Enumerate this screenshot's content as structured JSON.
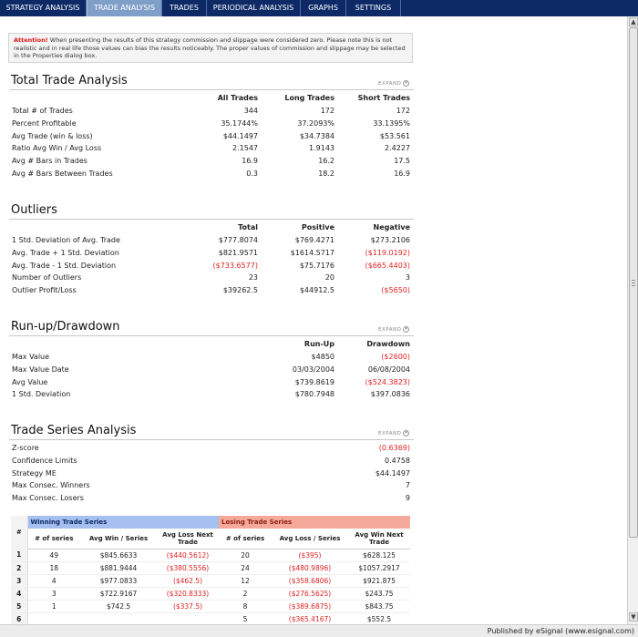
{
  "tabs": [
    "STRATEGY ANALYSIS",
    "TRADE ANALYSIS",
    "TRADES",
    "PERIODICAL ANALYSIS",
    "GRAPHS",
    "SETTINGS"
  ],
  "active_tab": "TRADE ANALYSIS",
  "attention": {
    "label": "Attention!",
    "text": "When presenting the results of this strategy commission and slippage were considered zero. Please note this is not realistic and in real life those values can bias the results noticeably. The proper values of commission and slippage may be selected in the Properties dialog box."
  },
  "expand_label": "EXPAND",
  "total_trade": {
    "title": "Total Trade Analysis",
    "headers": [
      "All Trades",
      "Long Trades",
      "Short Trades"
    ],
    "rows": [
      {
        "label": "Total # of Trades",
        "values": [
          "344",
          "172",
          "172"
        ]
      },
      {
        "label": "Percent Profitable",
        "values": [
          "35.1744%",
          "37.2093%",
          "33.1395%"
        ]
      },
      {
        "label": "Avg Trade (win & loss)",
        "values": [
          "$44.1497",
          "$34.7384",
          "$53.561"
        ]
      },
      {
        "label": "Ratio Avg Win / Avg Loss",
        "values": [
          "2.1547",
          "1.9143",
          "2.4227"
        ]
      },
      {
        "label": "Avg # Bars in Trades",
        "values": [
          "16.9",
          "16.2",
          "17.5"
        ]
      },
      {
        "label": "Avg # Bars Between Trades",
        "values": [
          "0.3",
          "18.2",
          "16.9"
        ]
      }
    ]
  },
  "outliers": {
    "title": "Outliers",
    "headers": [
      "Total",
      "Positive",
      "Negative"
    ],
    "rows": [
      {
        "label": "1 Std. Deviation of Avg. Trade",
        "values": [
          "$777.8074",
          "$769.4271",
          "$273.2106"
        ],
        "neg": [
          false,
          false,
          false
        ]
      },
      {
        "label": "Avg. Trade + 1 Std. Deviation",
        "values": [
          "$821.9571",
          "$1614.5717",
          "($119.0192)"
        ],
        "neg": [
          false,
          false,
          true
        ]
      },
      {
        "label": "Avg. Trade - 1 Std. Deviation",
        "values": [
          "($733.6577)",
          "$75.7176",
          "($665.4403)"
        ],
        "neg": [
          true,
          false,
          true
        ]
      },
      {
        "label": "Number of Outliers",
        "values": [
          "23",
          "20",
          "3"
        ],
        "neg": [
          false,
          false,
          false
        ]
      },
      {
        "label": "Outlier Profit/Loss",
        "values": [
          "$39262.5",
          "$44912.5",
          "($5650)"
        ],
        "neg": [
          false,
          false,
          true
        ]
      }
    ]
  },
  "runup": {
    "title": "Run-up/Drawdown",
    "headers": [
      "Run-Up",
      "Drawdown"
    ],
    "rows": [
      {
        "label": "Max Value",
        "values": [
          "$4850",
          "($2600)"
        ],
        "neg": [
          false,
          true
        ]
      },
      {
        "label": "Max Value Date",
        "values": [
          "03/03/2004",
          "06/08/2004"
        ],
        "neg": [
          false,
          false
        ]
      },
      {
        "label": "Avg Value",
        "values": [
          "$739.8619",
          "($524.3823)"
        ],
        "neg": [
          false,
          true
        ]
      },
      {
        "label": "1 Std. Deviation",
        "values": [
          "$780.7948",
          "$397.0836"
        ],
        "neg": [
          false,
          false
        ]
      }
    ]
  },
  "trade_series": {
    "title": "Trade Series Analysis",
    "rows": [
      {
        "label": "Z-score",
        "value": "(0.6369)",
        "neg": true
      },
      {
        "label": "Confidence Limits",
        "value": "0.4758",
        "neg": false
      },
      {
        "label": "Strategy ME",
        "value": "$44.1497",
        "neg": false
      },
      {
        "label": "Max Consec. Winners",
        "value": "7",
        "neg": false
      },
      {
        "label": "Max Consec. Losers",
        "value": "9",
        "neg": false
      }
    ]
  },
  "series_table": {
    "idx_header": "#",
    "win_header": "Winning Trade Series",
    "lose_header": "Losing Trade Series",
    "columns": [
      "# of series",
      "Avg Win / Series",
      "Avg Loss Next Trade",
      "# of series",
      "Avg Loss / Series",
      "Avg Win Next Trade"
    ],
    "rows": [
      {
        "idx": "1",
        "cells": [
          "49",
          "$845.6633",
          "($440.5612)",
          "20",
          "($395)",
          "$628.125"
        ]
      },
      {
        "idx": "2",
        "cells": [
          "18",
          "$881.9444",
          "($380.5556)",
          "24",
          "($480.9896)",
          "$1057.2917"
        ]
      },
      {
        "idx": "3",
        "cells": [
          "4",
          "$977.0833",
          "($462.5)",
          "12",
          "($358.6806)",
          "$921.875"
        ]
      },
      {
        "idx": "4",
        "cells": [
          "3",
          "$722.9167",
          "($320.8333)",
          "2",
          "($276.5625)",
          "$243.75"
        ]
      },
      {
        "idx": "5",
        "cells": [
          "1",
          "$742.5",
          "($337.5)",
          "8",
          "($389.6875)",
          "$843.75"
        ]
      },
      {
        "idx": "6",
        "cells": [
          "",
          "",
          "",
          "5",
          "($365.4167)",
          "$552.5"
        ]
      }
    ]
  },
  "status": "Published by eSignal (www.esignal.com)"
}
